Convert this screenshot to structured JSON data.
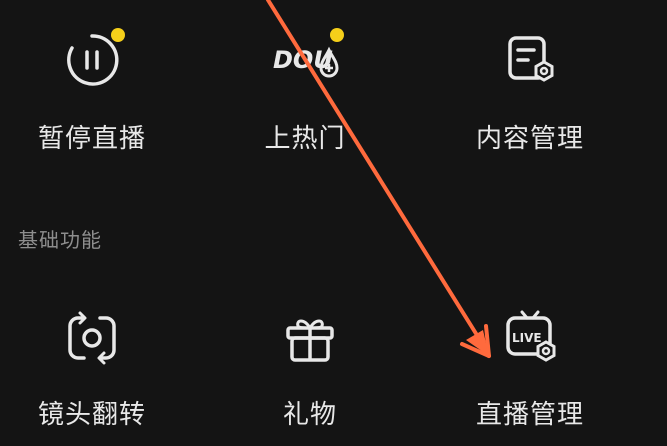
{
  "top_row": [
    {
      "label": "暂停直播",
      "icon": "pause-icon",
      "badge": true
    },
    {
      "label": "上热门",
      "icon": "dou-plus-icon",
      "badge": true,
      "icon_text": "DOU"
    },
    {
      "label": "内容管理",
      "icon": "content-settings-icon",
      "badge": false
    }
  ],
  "section": {
    "title": "基础功能"
  },
  "basic_row": [
    {
      "label": "镜头翻转",
      "icon": "camera-flip-icon"
    },
    {
      "label": "礼物",
      "icon": "gift-icon"
    },
    {
      "label": "直播管理",
      "icon": "live-settings-icon",
      "icon_text": "LIVE"
    }
  ],
  "colors": {
    "background": "#141414",
    "badge": "#f5cf1a",
    "arrow": "#ff6a3d",
    "icon_stroke": "#e8e8e8",
    "section_title": "#8e8e8e"
  }
}
